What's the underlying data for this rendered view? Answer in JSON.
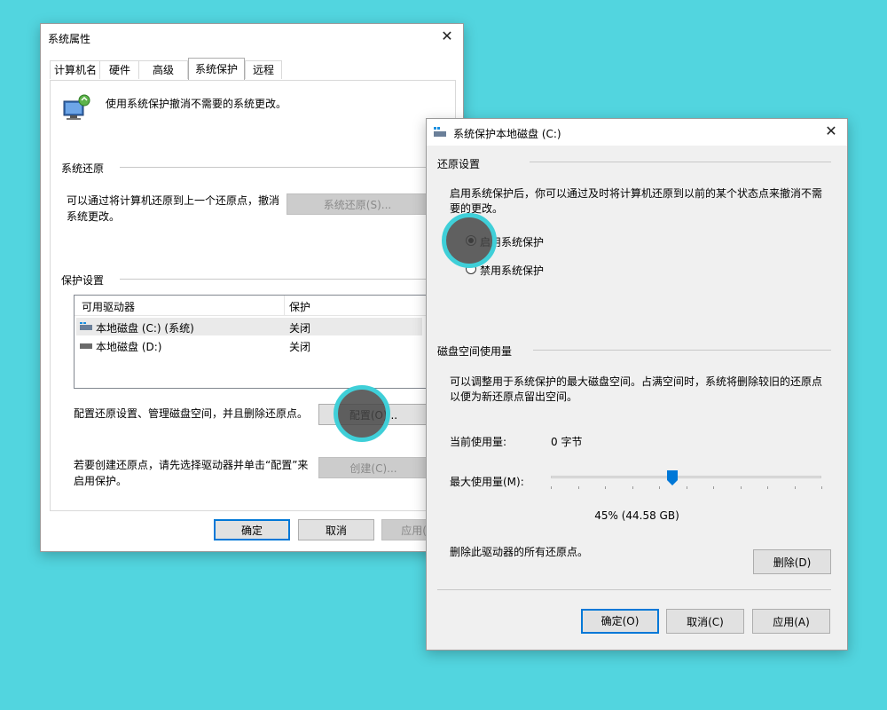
{
  "sysprops": {
    "title": "系统属性",
    "tabs": [
      "计算机名",
      "硬件",
      "高级",
      "系统保护",
      "远程"
    ],
    "intro": "使用系统保护撤消不需要的系统更改。",
    "restore_section": "系统还原",
    "restore_desc_1": "可以通过将计算机还原到上一个还原点，撤消",
    "restore_desc_2": "系统更改。",
    "restore_button": "系统还原(S)...",
    "protect_section": "保护设置",
    "list_headers": [
      "可用驱动器",
      "保护"
    ],
    "drives": [
      {
        "name": "本地磁盘 (C:) (系统)",
        "status": "关闭"
      },
      {
        "name": "本地磁盘 (D:)",
        "status": "关闭"
      }
    ],
    "config_desc": "配置还原设置、管理磁盘空间，并且删除还原点。",
    "config_button": "配置(O)...",
    "create_desc_1": "若要创建还原点，请先选择驱动器并单击“配置”来",
    "create_desc_2": "启用保护。",
    "create_button": "创建(C)...",
    "ok": "确定",
    "cancel": "取消",
    "apply": "应用(A)"
  },
  "protect": {
    "title": "系统保护本地磁盘 (C:)",
    "restore_settings": "还原设置",
    "enable_desc_1": "启用系统保护后，你可以通过及时将计算机还原到以前的某个状态点来撤消不需",
    "enable_desc_2": "要的更改。",
    "radio_enable": "启用系统保护",
    "radio_disable": "禁用系统保护",
    "disk_section": "磁盘空间使用量",
    "disk_desc_1": "可以调整用于系统保护的最大磁盘空间。占满空间时，系统将删除较旧的还原点",
    "disk_desc_2": "以便为新还原点留出空间。",
    "current_label": "当前使用量:",
    "current_value": "0 字节",
    "max_label": "最大使用量(M):",
    "max_value": "45% (44.58 GB)",
    "max_fraction": 0.45,
    "delete_desc": "删除此驱动器的所有还原点。",
    "delete_button": "删除(D)",
    "ok": "确定(O)",
    "cancel": "取消(C)",
    "apply": "应用(A)"
  },
  "colors": {
    "background": "#52d5df",
    "accent": "#0078d7",
    "highlight_ring": "#3fcfd8"
  }
}
